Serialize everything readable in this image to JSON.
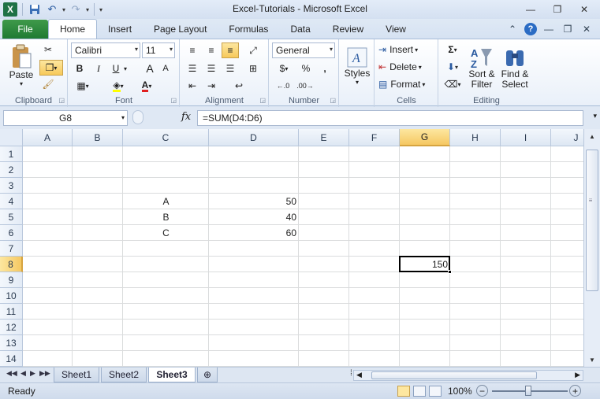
{
  "app": {
    "title": "Excel-Tutorials  -  Microsoft Excel",
    "logo_letter": "X"
  },
  "qat": {
    "icons": [
      "excel-logo-icon",
      "save-icon",
      "undo-icon",
      "redo-icon",
      "customize-qat-icon"
    ]
  },
  "window_controls": {
    "minimize": "—",
    "restore": "❐",
    "close": "✕"
  },
  "tabs": {
    "file": "File",
    "items": [
      "Home",
      "Insert",
      "Page Layout",
      "Formulas",
      "Data",
      "Review",
      "View"
    ],
    "active": "Home"
  },
  "ribbon": {
    "clipboard": {
      "label": "Clipboard",
      "paste": "Paste"
    },
    "font": {
      "label": "Font",
      "font_name": "Calibri",
      "font_size": "11",
      "bold": "B",
      "italic": "I",
      "underline": "U",
      "grow": "A",
      "shrink": "A"
    },
    "alignment": {
      "label": "Alignment"
    },
    "number": {
      "label": "Number",
      "format": "General",
      "currency": "$",
      "percent": "%",
      "comma": ",",
      "inc_decimal": "←.0\n.00",
      "dec_decimal": ".00\n→.0"
    },
    "styles": {
      "label": "Styles"
    },
    "cells": {
      "label": "Cells",
      "insert": "Insert",
      "delete": "Delete",
      "format": "Format"
    },
    "editing": {
      "label": "Editing",
      "sort_filter_1": "Sort &",
      "sort_filter_2": "Filter",
      "find_select_1": "Find &",
      "find_select_2": "Select",
      "sum": "Σ"
    }
  },
  "formula_bar": {
    "name_box": "G8",
    "fx": "fx",
    "formula": "=SUM(D4:D6)"
  },
  "grid": {
    "columns": [
      "A",
      "B",
      "C",
      "D",
      "E",
      "F",
      "G",
      "H",
      "I",
      "J"
    ],
    "rows": [
      "1",
      "2",
      "3",
      "4",
      "5",
      "6",
      "7",
      "8",
      "9",
      "10",
      "11",
      "12",
      "13",
      "14"
    ],
    "selected_column": "G",
    "selected_row": "8",
    "cells": {
      "C4": "A",
      "D4": "50",
      "C5": "B",
      "D5": "40",
      "C6": "C",
      "D6": "60",
      "G8": "150"
    }
  },
  "sheets": {
    "tabs": [
      "Sheet1",
      "Sheet2",
      "Sheet3"
    ],
    "active": "Sheet3"
  },
  "status_bar": {
    "status": "Ready",
    "zoom": "100%"
  }
}
